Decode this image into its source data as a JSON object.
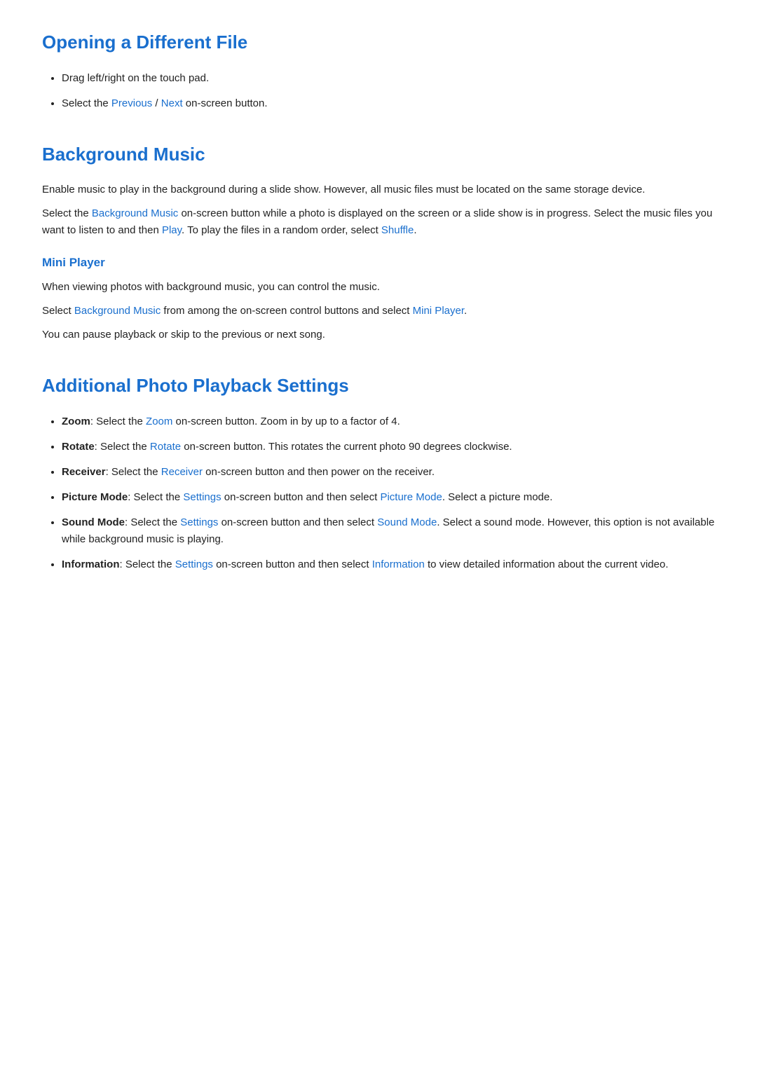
{
  "sections": [
    {
      "id": "opening-different-file",
      "title": "Opening a Different File",
      "bullets": [
        {
          "text_before": "Drag left/right on the touch pad.",
          "links": []
        },
        {
          "text_before": "Select the ",
          "links": [
            {
              "label": "Previous",
              "position": 1
            },
            {
              "label": "Next",
              "position": 3
            }
          ],
          "parts": [
            "Select the ",
            "Previous",
            " / ",
            "Next",
            " on-screen button."
          ]
        }
      ]
    },
    {
      "id": "background-music",
      "title": "Background Music",
      "paragraphs": [
        {
          "text": "Enable music to play in the background during a slide show. However, all music files must be located on the same storage device."
        },
        {
          "parts": [
            "Select the ",
            {
              "link": "Background Music"
            },
            " on-screen button while a photo is displayed on the screen or a slide show is in progress. Select the music files you want to listen to and then ",
            {
              "link": "Play"
            },
            ". To play the files in a random order, select ",
            {
              "link": "Shuffle"
            },
            "."
          ]
        }
      ],
      "subsections": [
        {
          "id": "mini-player",
          "title": "Mini Player",
          "paragraphs": [
            {
              "text": "When viewing photos with background music, you can control the music."
            },
            {
              "parts": [
                "Select ",
                {
                  "link": "Background Music"
                },
                " from among the on-screen control buttons and select ",
                {
                  "link": "Mini Player"
                },
                "."
              ]
            },
            {
              "text": "You can pause playback or skip to the previous or next song."
            }
          ]
        }
      ]
    },
    {
      "id": "additional-photo-playback-settings",
      "title": "Additional Photo Playback Settings",
      "bullets": [
        {
          "bold": "Zoom",
          "parts": [
            {
              "bold": "Zoom"
            },
            ": Select the ",
            {
              "link": "Zoom"
            },
            " on-screen button. Zoom in by up to a factor of 4."
          ]
        },
        {
          "parts": [
            {
              "bold": "Rotate"
            },
            ": Select the ",
            {
              "link": "Rotate"
            },
            " on-screen button. This rotates the current photo 90 degrees clockwise."
          ]
        },
        {
          "parts": [
            {
              "bold": "Receiver"
            },
            ": Select the ",
            {
              "link": "Receiver"
            },
            " on-screen button and then power on the receiver."
          ]
        },
        {
          "parts": [
            {
              "bold": "Picture Mode"
            },
            ": Select the ",
            {
              "link": "Settings"
            },
            " on-screen button and then select ",
            {
              "link": "Picture Mode"
            },
            ". Select a picture mode."
          ]
        },
        {
          "parts": [
            {
              "bold": "Sound Mode"
            },
            ": Select the ",
            {
              "link": "Settings"
            },
            " on-screen button and then select ",
            {
              "link": "Sound Mode"
            },
            ". Select a sound mode. However, this option is not available while background music is playing."
          ]
        },
        {
          "parts": [
            {
              "bold": "Information"
            },
            ": Select the ",
            {
              "link": "Settings"
            },
            " on-screen button and then select ",
            {
              "link": "Information"
            },
            " to view detailed information about the current video."
          ]
        }
      ]
    }
  ],
  "colors": {
    "heading": "#1a6fce",
    "link": "#1a6fce",
    "text": "#222222",
    "background": "#ffffff"
  }
}
